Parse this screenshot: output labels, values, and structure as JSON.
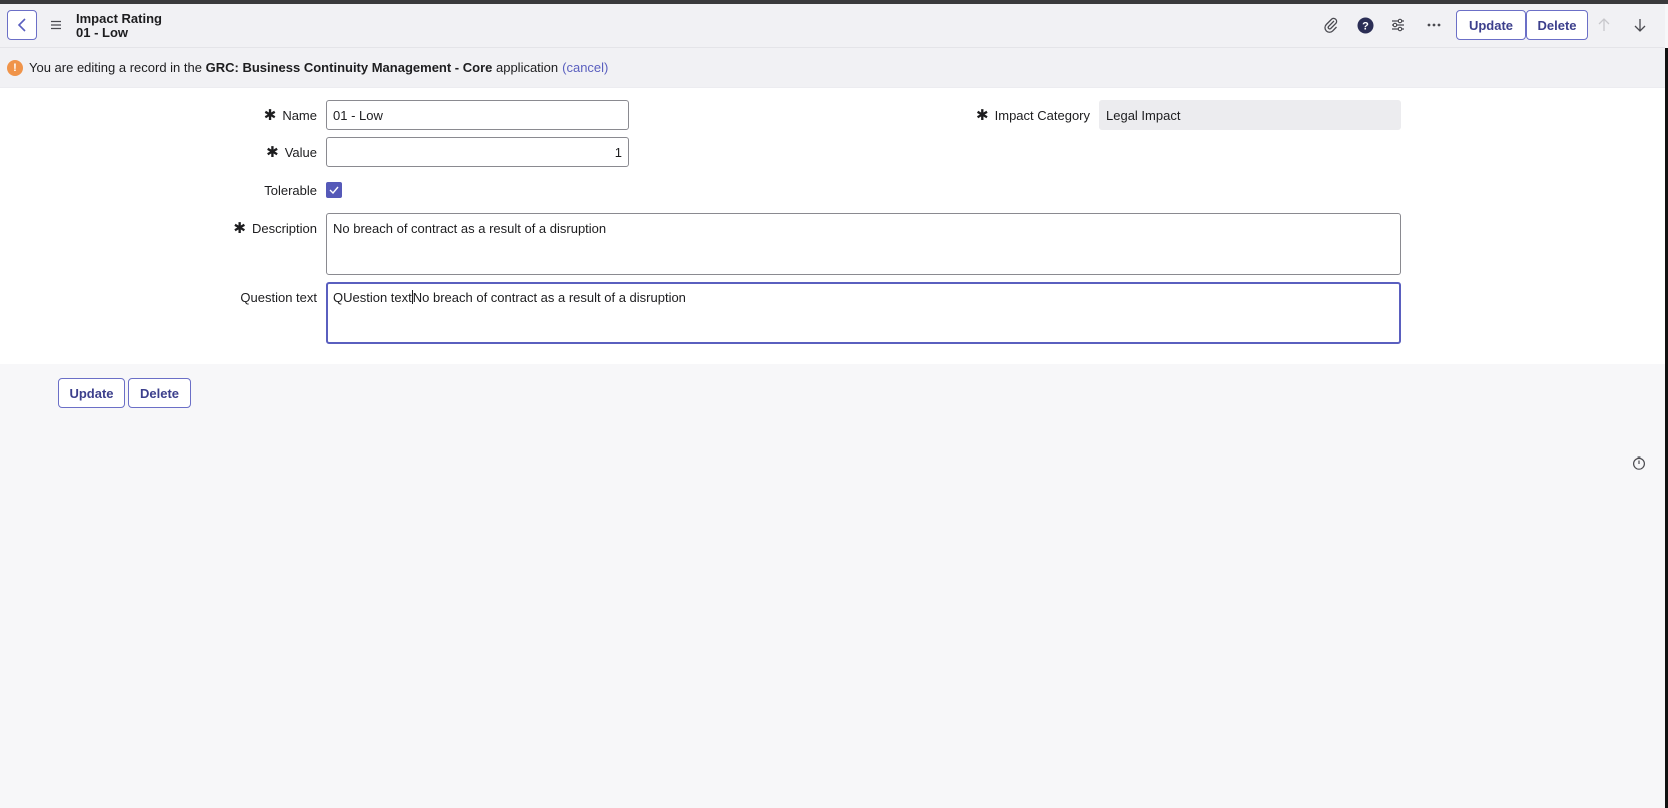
{
  "header": {
    "table_name": "Impact Rating",
    "record_name": "01 - Low",
    "update_label": "Update",
    "delete_label": "Delete"
  },
  "notice": {
    "prefix": "You are editing a record in the",
    "app_name": "GRC: Business Continuity Management - Core",
    "suffix": "application",
    "cancel_label": "(cancel)"
  },
  "form": {
    "name": {
      "label": "Name",
      "value": "01 - Low",
      "required": true
    },
    "value": {
      "label": "Value",
      "value": "1",
      "required": true
    },
    "tolerable": {
      "label": "Tolerable",
      "checked": true
    },
    "description": {
      "label": "Description",
      "value": "No breach of contract as a result of a disruption",
      "required": true
    },
    "question_text": {
      "label": "Question text",
      "value_before_caret": "QUestion text",
      "value_after_caret": "No breach of contract as a result of a disruption"
    },
    "impact_category": {
      "label": "Impact Category",
      "value": "Legal Impact",
      "required": true
    }
  },
  "footer": {
    "update_label": "Update",
    "delete_label": "Delete"
  },
  "icons": {
    "back": "chevron-left-icon",
    "menu": "hamburger-menu-icon",
    "attachment": "paperclip-icon",
    "help": "question-circle-icon",
    "settings": "sliders-icon",
    "more": "ellipsis-icon",
    "prev": "arrow-up-icon",
    "next": "arrow-down-icon",
    "warning": "exclamation-circle-icon",
    "timer": "stopwatch-icon"
  },
  "colors": {
    "accent": "#5559b8",
    "warning": "#f0944a"
  }
}
